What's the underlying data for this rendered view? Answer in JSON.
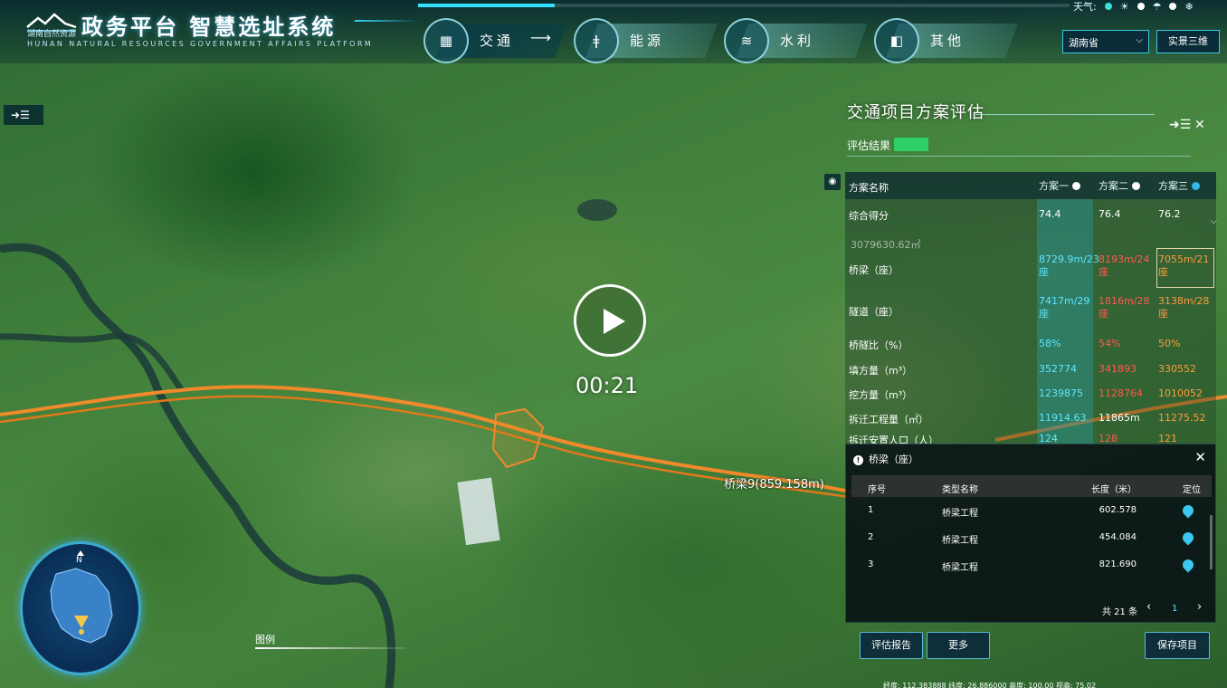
{
  "header": {
    "org_name": "湖南自然资源",
    "title": "政务平台 智慧选址系统",
    "subtitle": "HUNAN NATURAL RESOURCES GOVERNMENT AFFAIRS PLATFORM",
    "weather_label": "天气:"
  },
  "nav": {
    "items": [
      {
        "label": "交通",
        "arrow": "⟶",
        "icon": "road-icon",
        "glyph": "▦"
      },
      {
        "label": "能源",
        "icon": "energy-icon",
        "glyph": "ǂ"
      },
      {
        "label": "水利",
        "icon": "water-icon",
        "glyph": "≋"
      },
      {
        "label": "其他",
        "icon": "other-icon",
        "glyph": "◧"
      }
    ]
  },
  "toolbar": {
    "region": "湖南省",
    "view_mode": "实景三维",
    "left_toggle": "➜☰"
  },
  "map": {
    "bridge_label": "桥梁9(859.158m)",
    "legend": "图例"
  },
  "panel": {
    "title": "交通项目方案评估",
    "expand_icon": "➜☰",
    "close_icon": "✕",
    "eval_label": "评估结果",
    "side_icon": "◉",
    "columns": [
      "方案一",
      "方案二",
      "方案三"
    ],
    "column_colors": [
      "#ffffff",
      "#ffffff",
      "#33b8e8"
    ],
    "header_label": "方案名称",
    "score_label": "综合得分",
    "scores": [
      "74.4",
      "76.4",
      "76.2"
    ],
    "partial_value": "3079630.62㎡",
    "rows": [
      {
        "label": "桥梁（座）",
        "v1": "8729.9m/23座",
        "v2": "8193m/24座",
        "v3": "7055m/21座"
      },
      {
        "label": "隧道（座）",
        "v1": "7417m/29座",
        "v2": "1816m/28座",
        "v3": "3138m/28座"
      },
      {
        "label": "桥隧比（%）",
        "v1": "58%",
        "v2": "54%",
        "v3": "50%"
      },
      {
        "label": "填方量（m³）",
        "v1": "352774",
        "v2": "341893",
        "v3": "330552"
      },
      {
        "label": "挖方量（m³）",
        "v1": "1239875",
        "v2": "1128764",
        "v3": "1010052"
      },
      {
        "label": "拆迁工程量（㎡）",
        "v1": "11914.63",
        "v2": "11865m",
        "v3": "11275.52"
      },
      {
        "label": "拆迁安置人口（人）",
        "v1": "124",
        "v2": "128",
        "v3": "121"
      }
    ]
  },
  "bridge": {
    "title": "桥梁（座）",
    "close": "✕",
    "headers": [
      "序号",
      "类型名称",
      "长度（米）",
      "定位"
    ],
    "rows": [
      {
        "no": "1",
        "type": "桥梁工程",
        "length": "602.578"
      },
      {
        "no": "2",
        "type": "桥梁工程",
        "length": "454.084"
      },
      {
        "no": "3",
        "type": "桥梁工程",
        "length": "821.690"
      }
    ],
    "total": "共 21 条",
    "page": "1",
    "prev": "‹",
    "next": "›"
  },
  "actions": {
    "report": "评估报告",
    "more": "更多",
    "save": "保存项目"
  },
  "video": {
    "time": "00:21",
    "progress": 0.21
  },
  "status_bar": "经度: 112.383888   纬度: 26.886000   高度: 100.00   视高: 75.02",
  "compass": {
    "north": "N"
  }
}
